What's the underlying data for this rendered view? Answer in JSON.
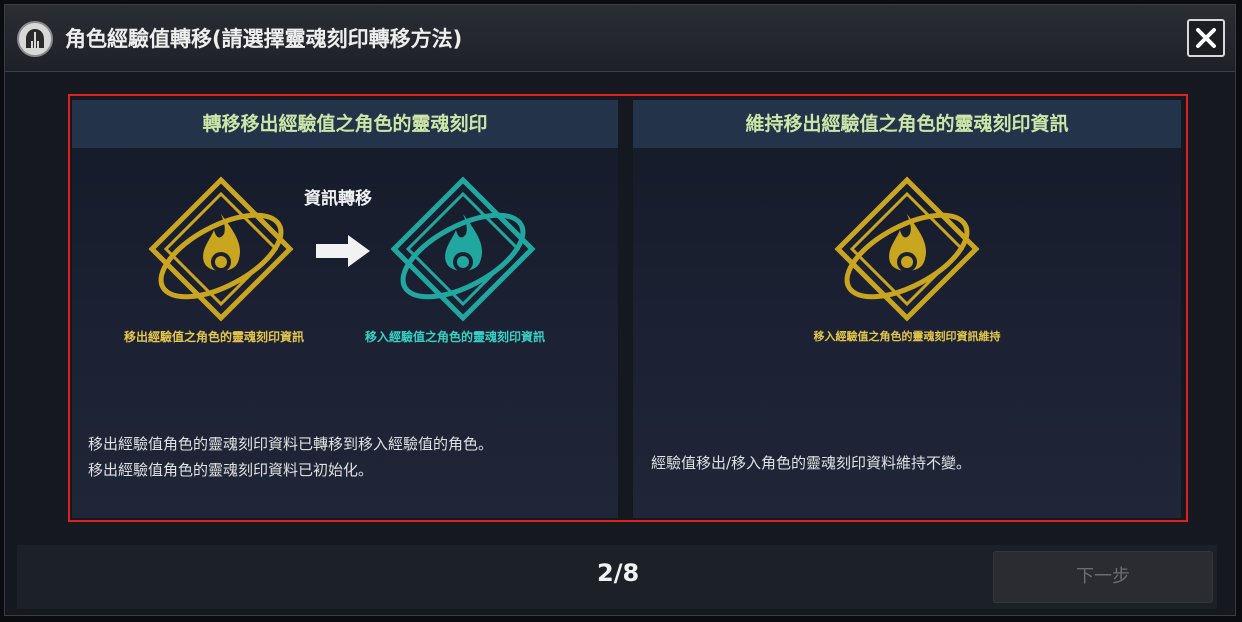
{
  "dialog": {
    "title": "角色經驗值轉移(請選擇靈魂刻印轉移方法)"
  },
  "options": [
    {
      "heading": "轉移移出經驗值之角色的靈魂刻印",
      "transfer_label": "資訊轉移",
      "source_caption": "移出經驗值之角色的靈魂刻印資訊",
      "target_caption": "移入經驗值之角色的靈魂刻印資訊",
      "description": [
        "移出經驗值角色的靈魂刻印資料已轉移到移入經驗值的角色。",
        "移出經驗值角色的靈魂刻印資料已初始化。"
      ]
    },
    {
      "heading": "維持移出經驗值之角色的靈魂刻印資訊",
      "caption": "移入經驗值之角色的靈魂刻印資訊維持",
      "description": [
        "經驗值移出/移入角色的靈魂刻印資料維持不變。"
      ]
    }
  ],
  "footer": {
    "page": "2/8",
    "next_label": "下一步"
  },
  "colors": {
    "highlight_border": "#e02020",
    "gold": "#c9a520",
    "teal": "#1fa7a0",
    "heading_text": "#cde6a8"
  }
}
